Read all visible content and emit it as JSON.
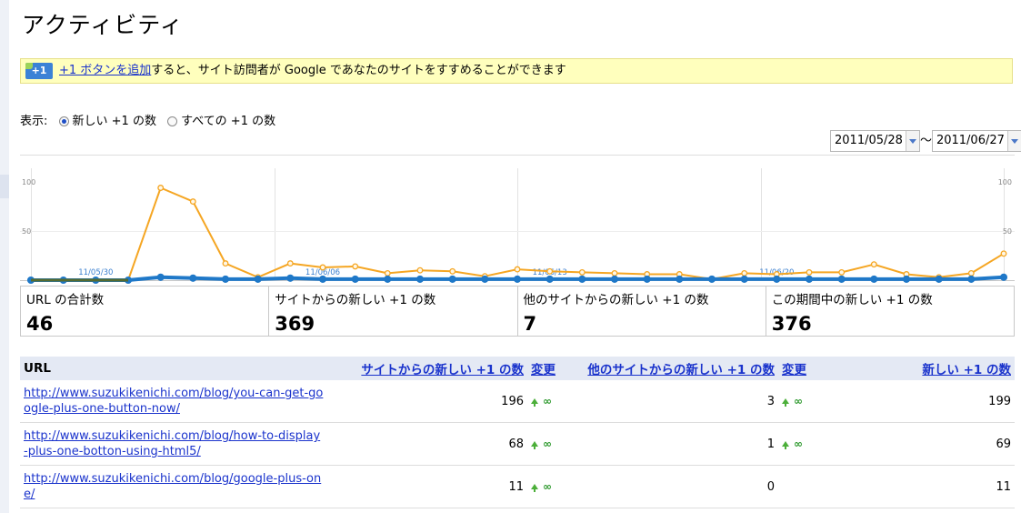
{
  "title": "アクティビティ",
  "notice": {
    "link": "+1 ボタンを追加",
    "text": "すると、サイト訪問者が Google であなたのサイトをすすめることができます"
  },
  "display": {
    "label": "表示:",
    "option_new": "新しい +1 の数",
    "option_all": "すべての +1 の数",
    "selected": "option_new"
  },
  "date_range": {
    "start": "2011/05/28",
    "separator": "〜",
    "end": "2011/06/27"
  },
  "chart_data": {
    "type": "line",
    "x": [
      "05/28",
      "05/29",
      "05/30",
      "05/31",
      "06/01",
      "06/02",
      "06/03",
      "06/04",
      "06/05",
      "06/06",
      "06/07",
      "06/08",
      "06/09",
      "06/10",
      "06/11",
      "06/12",
      "06/13",
      "06/14",
      "06/15",
      "06/16",
      "06/17",
      "06/18",
      "06/19",
      "06/20",
      "06/21",
      "06/22",
      "06/23",
      "06/24",
      "06/25",
      "06/26",
      "06/27"
    ],
    "x_tick_labels": [
      "11/05/30",
      "11/06/06",
      "11/06/13",
      "11/06/20"
    ],
    "y_ticks": [
      "100",
      "50"
    ],
    "ylim": [
      0,
      100
    ],
    "colors": {
      "orange": "#f5a623",
      "blue": "#1f78c8"
    },
    "series": [
      {
        "values": [
          0,
          0,
          0,
          0,
          94,
          80,
          17,
          3,
          17,
          13,
          14,
          7,
          10,
          9,
          4,
          11,
          9,
          8,
          7,
          6,
          6,
          1,
          7,
          6,
          8,
          8,
          16,
          6,
          3,
          7,
          27
        ]
      },
      {
        "values": [
          0,
          0,
          0,
          0,
          3,
          2,
          1,
          1,
          2,
          1,
          1,
          1,
          1,
          1,
          1,
          1,
          1,
          1,
          1,
          1,
          1,
          1,
          1,
          1,
          1,
          1,
          1,
          1,
          1,
          1,
          3
        ]
      }
    ]
  },
  "stats": [
    {
      "label": "URL の合計数",
      "value": "46"
    },
    {
      "label": "サイトからの新しい +1 の数",
      "value": "369"
    },
    {
      "label": "他のサイトからの新しい +1 の数",
      "value": "7"
    },
    {
      "label": "この期間中の新しい +1 の数",
      "value": "376"
    }
  ],
  "table": {
    "headers": {
      "url": "URL",
      "site_new": "サイトからの新しい +1 の数",
      "change1": "変更",
      "other_new": "他のサイトからの新しい +1 の数",
      "change2": "変更",
      "new_total": "新しい +1 の数"
    },
    "rows": [
      {
        "url": "http://www.suzukikenichi.com/blog/you-can-get-google-plus-one-button-now/",
        "site_new": "196",
        "change1": "∞",
        "other_new": "3",
        "change2": "∞",
        "new_total": "199"
      },
      {
        "url": "http://www.suzukikenichi.com/blog/how-to-display-plus-one-botton-using-html5/",
        "site_new": "68",
        "change1": "∞",
        "other_new": "1",
        "change2": "∞",
        "new_total": "69"
      },
      {
        "url": "http://www.suzukikenichi.com/blog/google-plus-one/",
        "site_new": "11",
        "change1": "∞",
        "other_new": "0",
        "change2": "",
        "new_total": "11"
      }
    ]
  }
}
